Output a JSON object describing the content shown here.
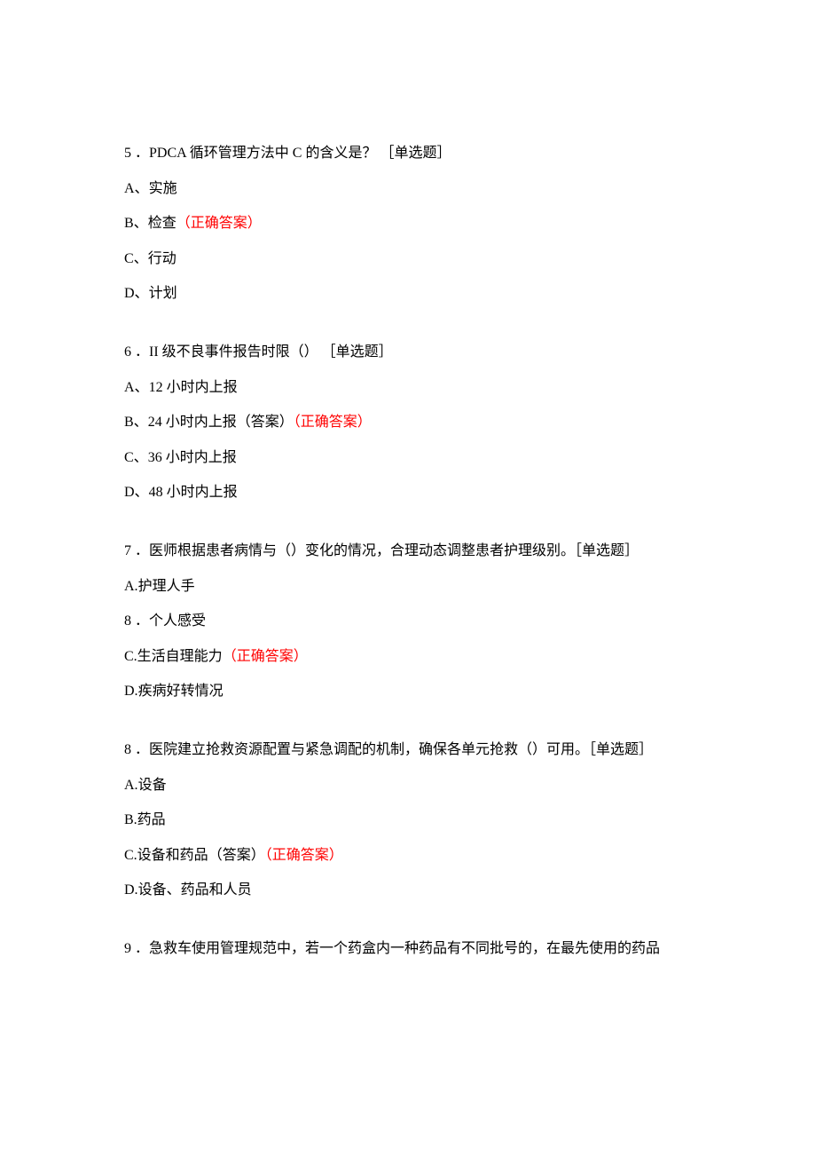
{
  "questions": [
    {
      "number": "5",
      "text": "．PDCA 循环管理方法中 C 的含义是？ ［单选题］",
      "options": [
        {
          "label": "A、",
          "text": "实施",
          "note": "",
          "correct": ""
        },
        {
          "label": "B、",
          "text": "检查",
          "note": "",
          "correct": "（正确答案）"
        },
        {
          "label": "C、",
          "text": "行动",
          "note": "",
          "correct": ""
        },
        {
          "label": "D、",
          "text": "计划",
          "note": "",
          "correct": ""
        }
      ]
    },
    {
      "number": "6",
      "text": "．II 级不良事件报告时限（） ［单选题］",
      "options": [
        {
          "label": "A、",
          "text": "12 小时内上报",
          "note": "",
          "correct": ""
        },
        {
          "label": "B、",
          "text": "24 小时内上报",
          "note": "（答案）",
          "correct": "（正确答案）"
        },
        {
          "label": "C、",
          "text": "36 小时内上报",
          "note": "",
          "correct": ""
        },
        {
          "label": "D、",
          "text": "48 小时内上报",
          "note": "",
          "correct": ""
        }
      ]
    },
    {
      "number": "7",
      "text": "．医师根据患者病情与（）变化的情况，合理动态调整患者护理级别。［单选题］",
      "options": [
        {
          "label": "A.",
          "text": "护理人手",
          "note": "",
          "correct": ""
        },
        {
          "label": "8 ．",
          "text": "个人感受",
          "note": "",
          "correct": ""
        },
        {
          "label": "C.",
          "text": "生活自理能力",
          "note": "",
          "correct": "（正确答案）"
        },
        {
          "label": "D.",
          "text": "疾病好转情况",
          "note": "",
          "correct": ""
        }
      ]
    },
    {
      "number": "8",
      "text": "．医院建立抢救资源配置与紧急调配的机制，确保各单元抢救（）可用。［单选题］",
      "options": [
        {
          "label": "A.",
          "text": "设备",
          "note": "",
          "correct": ""
        },
        {
          "label": "B.",
          "text": "药品",
          "note": "",
          "correct": ""
        },
        {
          "label": "C.",
          "text": "设备和药品",
          "note": "（答案）",
          "correct": "（正确答案）"
        },
        {
          "label": "D.",
          "text": "设备、药品和人员",
          "note": "",
          "correct": ""
        }
      ]
    },
    {
      "number": "9",
      "text": "．急救车使用管理规范中，若一个药盒内一种药品有不同批号的，在最先使用的药品",
      "options": []
    }
  ]
}
